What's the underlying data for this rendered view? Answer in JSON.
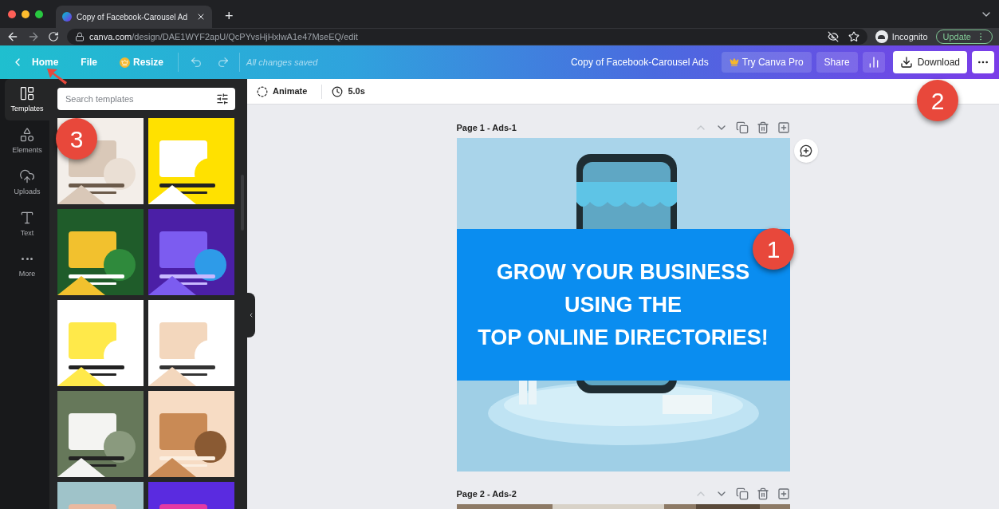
{
  "browser": {
    "tab_title": "Copy of Facebook-Carousel Ad",
    "new_tab": "+",
    "url_domain": "canva.com",
    "url_path": "/design/DAE1WYF2apU/QcPYvsHjHxlwA1e47MseEQ/edit",
    "profile": "Incognito",
    "update": "Update"
  },
  "toolbar": {
    "home": "Home",
    "file": "File",
    "resize": "Resize",
    "save_status": "All changes saved",
    "doc_title": "Copy of Facebook-Carousel Ads",
    "try_pro": "Try Canva Pro",
    "share": "Share",
    "download": "Download"
  },
  "sidebar": {
    "items": [
      {
        "label": "Templates",
        "kind": "templates",
        "selected": true
      },
      {
        "label": "Elements",
        "kind": "elements",
        "selected": false
      },
      {
        "label": "Uploads",
        "kind": "uploads",
        "selected": false
      },
      {
        "label": "Text",
        "kind": "text",
        "selected": false
      },
      {
        "label": "More",
        "kind": "more",
        "selected": false
      }
    ]
  },
  "templates_panel": {
    "search": {
      "placeholder": "Search templates"
    }
  },
  "editor": {
    "animate": "Animate",
    "duration": "5.0s",
    "pages": [
      {
        "label": "Page 1 - Ads-1",
        "headline_lines": [
          "GROW YOUR BUSINESS",
          "USING THE",
          "TOP ONLINE DIRECTORIES!"
        ]
      },
      {
        "label": "Page 2 - Ads-2"
      }
    ]
  },
  "annotations": [
    {
      "label": "1"
    },
    {
      "label": "2"
    },
    {
      "label": "3"
    }
  ]
}
